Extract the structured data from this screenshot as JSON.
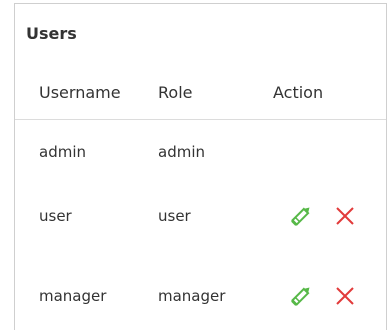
{
  "panel": {
    "title": "Users"
  },
  "table": {
    "columns": [
      "Username",
      "Role",
      "Action"
    ],
    "rows": [
      {
        "username": "admin",
        "role": "admin",
        "actions": []
      },
      {
        "username": "user",
        "role": "user",
        "actions": [
          "edit-icon",
          "delete-icon"
        ]
      },
      {
        "username": "manager",
        "role": "manager",
        "actions": [
          "edit-icon",
          "delete-icon"
        ]
      }
    ]
  },
  "colors": {
    "edit": "#57b848",
    "delete": "#e23b3b",
    "border": "#cfcfcf",
    "text": "#333333"
  }
}
